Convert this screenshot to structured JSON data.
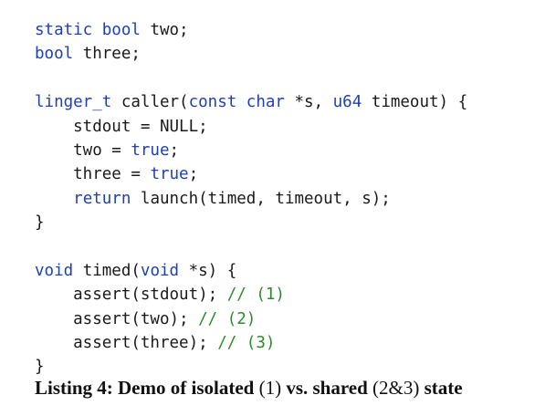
{
  "code": {
    "language": "C",
    "lines": [
      [
        {
          "t": "static bool",
          "k": "kw"
        },
        {
          "t": " two;",
          "k": "tx"
        }
      ],
      [
        {
          "t": "bool",
          "k": "kw"
        },
        {
          "t": " three;",
          "k": "tx"
        }
      ],
      [],
      [
        {
          "t": "linger_t",
          "k": "kw"
        },
        {
          "t": " caller(",
          "k": "tx"
        },
        {
          "t": "const char",
          "k": "kw"
        },
        {
          "t": " *s, ",
          "k": "tx"
        },
        {
          "t": "u64",
          "k": "kw"
        },
        {
          "t": " timeout) {",
          "k": "tx"
        }
      ],
      [
        {
          "t": "    stdout = NULL;",
          "k": "tx"
        }
      ],
      [
        {
          "t": "    two = ",
          "k": "tx"
        },
        {
          "t": "true",
          "k": "kw"
        },
        {
          "t": ";",
          "k": "tx"
        }
      ],
      [
        {
          "t": "    three = ",
          "k": "tx"
        },
        {
          "t": "true",
          "k": "kw"
        },
        {
          "t": ";",
          "k": "tx"
        }
      ],
      [
        {
          "t": "    ",
          "k": "tx"
        },
        {
          "t": "return",
          "k": "kw"
        },
        {
          "t": " launch(timed, timeout, s);",
          "k": "tx"
        }
      ],
      [
        {
          "t": "}",
          "k": "tx"
        }
      ],
      [],
      [
        {
          "t": "void",
          "k": "kw"
        },
        {
          "t": " timed(",
          "k": "tx"
        },
        {
          "t": "void",
          "k": "kw"
        },
        {
          "t": " *s) {",
          "k": "tx"
        }
      ],
      [
        {
          "t": "    assert(stdout); ",
          "k": "tx"
        },
        {
          "t": "// (1)",
          "k": "cm"
        }
      ],
      [
        {
          "t": "    assert(two); ",
          "k": "tx"
        },
        {
          "t": "// (2)",
          "k": "cm"
        }
      ],
      [
        {
          "t": "    assert(three); ",
          "k": "tx"
        },
        {
          "t": "// (3)",
          "k": "cm"
        }
      ],
      [
        {
          "t": "}",
          "k": "tx"
        }
      ]
    ]
  },
  "caption": {
    "segments": [
      {
        "t": "Listing 4: Demo of isolated ",
        "w": "bold"
      },
      {
        "t": "(1)",
        "w": "reg"
      },
      {
        "t": " vs. shared ",
        "w": "bold"
      },
      {
        "t": "(2&3)",
        "w": "reg"
      },
      {
        "t": " state",
        "w": "bold"
      }
    ]
  },
  "colors": {
    "keyword": "#1f3fb4",
    "comment": "#2c8a2c",
    "text": "#1a1a1a",
    "background": "#ffffff"
  }
}
